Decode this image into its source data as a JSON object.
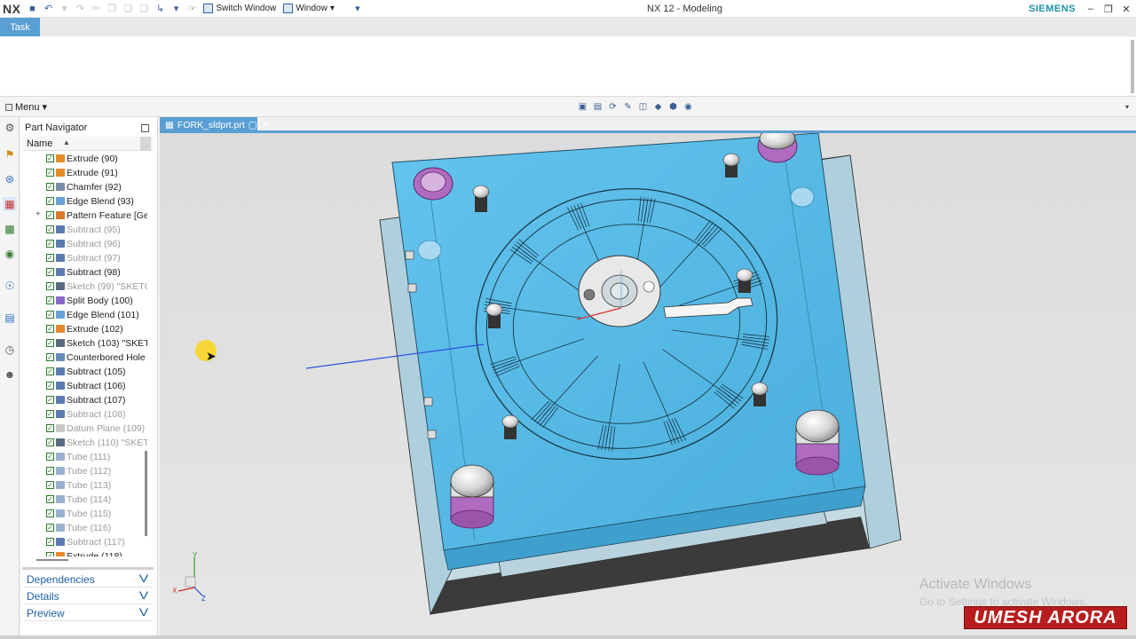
{
  "titlebar": {
    "app_logo": "NX",
    "title": "NX 12 - Modeling",
    "brand": "SIEMENS",
    "switch_window_label": "Switch Window",
    "window_menu_label": "Window"
  },
  "ribbon": {
    "tab_task": "Task"
  },
  "topbar": {
    "menu_label": "Menu"
  },
  "navigator": {
    "title": "Part Navigator",
    "column_name": "Name",
    "items": [
      {
        "label": "Extrude (90)",
        "dim": false,
        "icon": "extrude-icon"
      },
      {
        "label": "Extrude (91)",
        "dim": false,
        "icon": "extrude-icon"
      },
      {
        "label": "Chamfer (92)",
        "dim": false,
        "icon": "chamfer-icon"
      },
      {
        "label": "Edge Blend (93)",
        "dim": false,
        "icon": "edge-blend-icon"
      },
      {
        "label": "Pattern Feature [Ge",
        "dim": false,
        "icon": "pattern-icon",
        "expandable": true
      },
      {
        "label": "Subtract (95)",
        "dim": true,
        "icon": "subtract-icon"
      },
      {
        "label": "Subtract (96)",
        "dim": true,
        "icon": "subtract-icon"
      },
      {
        "label": "Subtract (97)",
        "dim": true,
        "icon": "subtract-icon"
      },
      {
        "label": "Subtract (98)",
        "dim": false,
        "icon": "subtract-icon"
      },
      {
        "label": "Sketch (99) \"SKETC",
        "dim": true,
        "icon": "sketch-icon"
      },
      {
        "label": "Split Body (100)",
        "dim": false,
        "icon": "split-body-icon"
      },
      {
        "label": "Edge Blend (101)",
        "dim": false,
        "icon": "edge-blend-icon"
      },
      {
        "label": "Extrude (102)",
        "dim": false,
        "icon": "extrude-icon"
      },
      {
        "label": "Sketch (103) \"SKET",
        "dim": false,
        "icon": "sketch-icon"
      },
      {
        "label": "Counterbored Hole",
        "dim": false,
        "icon": "hole-icon"
      },
      {
        "label": "Subtract (105)",
        "dim": false,
        "icon": "subtract-icon"
      },
      {
        "label": "Subtract (106)",
        "dim": false,
        "icon": "subtract-icon"
      },
      {
        "label": "Subtract (107)",
        "dim": false,
        "icon": "subtract-icon"
      },
      {
        "label": "Subtract (108)",
        "dim": true,
        "icon": "subtract-icon"
      },
      {
        "label": "Datum Plane (109)",
        "dim": true,
        "icon": "datum-plane-icon"
      },
      {
        "label": "Sketch (110) \"SKET",
        "dim": true,
        "icon": "sketch-icon"
      },
      {
        "label": "Tube (111)",
        "dim": true,
        "icon": "tube-icon"
      },
      {
        "label": "Tube (112)",
        "dim": true,
        "icon": "tube-icon"
      },
      {
        "label": "Tube (113)",
        "dim": true,
        "icon": "tube-icon"
      },
      {
        "label": "Tube (114)",
        "dim": true,
        "icon": "tube-icon"
      },
      {
        "label": "Tube (115)",
        "dim": true,
        "icon": "tube-icon"
      },
      {
        "label": "Tube (116)",
        "dim": true,
        "icon": "tube-icon"
      },
      {
        "label": "Subtract (117)",
        "dim": true,
        "icon": "subtract-icon"
      },
      {
        "label": "Extrude (118)",
        "dim": false,
        "icon": "extrude-icon"
      }
    ],
    "panels": {
      "dependencies": "Dependencies",
      "details": "Details",
      "preview": "Preview"
    }
  },
  "document_tab": {
    "label": "FORK_sldprt.prt"
  },
  "viewport": {
    "triad_labels": {
      "x": "X",
      "y": "Y",
      "z": "Z"
    }
  },
  "overlay": {
    "activate_title": "Activate Windows",
    "activate_sub": "Go to Settings to activate Windows.",
    "channel_brand": "UMESH ARORA"
  },
  "colors": {
    "accent": "#5a9fd4",
    "mold_plate": "#5bbce8",
    "brand_text": "#1a93a8",
    "watermark_bg": "#b81c1c"
  }
}
